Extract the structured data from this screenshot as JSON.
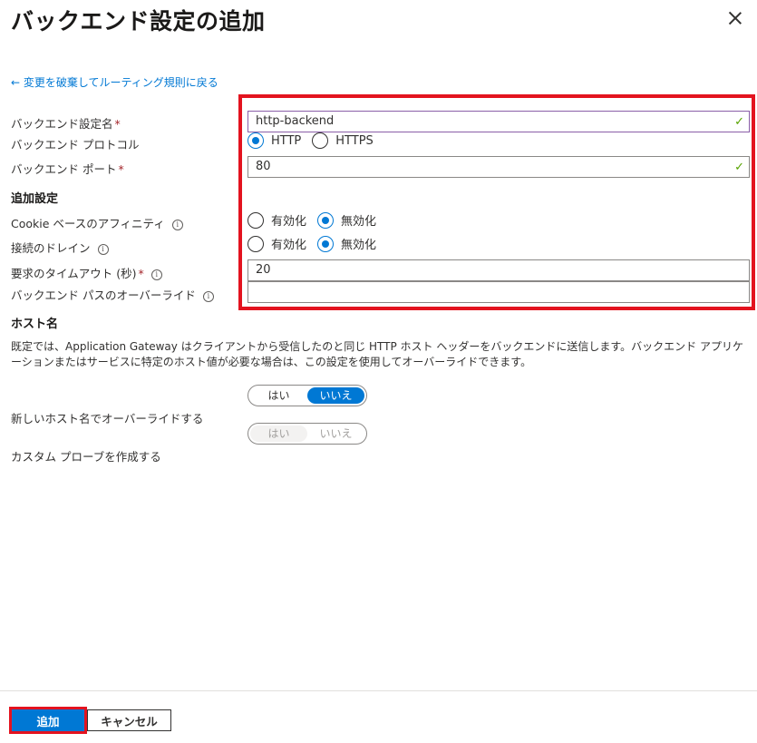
{
  "panel": {
    "title": "バックエンド設定の追加",
    "back_link": "← 変更を破棄してルーティング規則に戻る"
  },
  "fields": {
    "name_label": "バックエンド設定名",
    "name_value": "http-backend",
    "protocol_label": "バックエンド プロトコル",
    "protocol_options": [
      "HTTP",
      "HTTPS"
    ],
    "protocol_selected": "HTTP",
    "port_label": "バックエンド ポート",
    "port_value": "80",
    "required_mark": "*"
  },
  "additional": {
    "section_title": "追加設定",
    "cookie_label": "Cookie ベースのアフィニティ",
    "drain_label": "接続のドレイン",
    "enable": "有効化",
    "disable": "無効化",
    "cookie_selected": "無効化",
    "drain_selected": "無効化",
    "timeout_label": "要求のタイムアウト (秒)",
    "timeout_value": "20",
    "path_label": "バックエンド パスのオーバーライド",
    "path_value": ""
  },
  "host": {
    "section_title": "ホスト名",
    "description": "既定では、Application Gateway はクライアントから受信したのと同じ HTTP ホスト ヘッダーをバックエンドに送信します。バックエンド アプリケーションまたはサービスに特定のホスト値が必要な場合は、この設定を使用してオーバーライドできます。",
    "override_label": "新しいホスト名でオーバーライドする",
    "probe_label": "カスタム プローブを作成する",
    "yes": "はい",
    "no": "いいえ",
    "override_selected": "いいえ",
    "probe_selected": "はい"
  },
  "footer": {
    "add_label": "追加",
    "cancel_label": "キャンセル"
  },
  "colors": {
    "accent": "#0078d4",
    "highlight": "#e3131f",
    "valid": "#57a300"
  }
}
